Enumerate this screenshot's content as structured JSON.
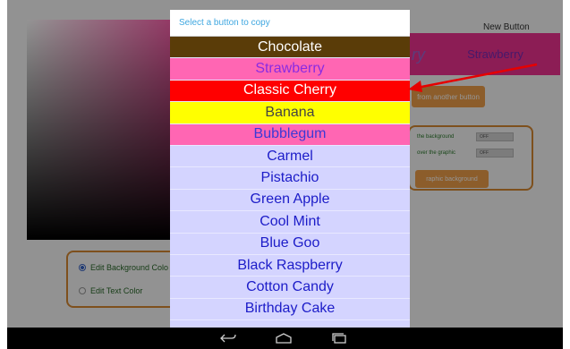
{
  "app": {
    "new_button_label": "New Button",
    "preview_text": "Strawberry",
    "preview_peek_text": "ry",
    "copy_button_label": "from another button",
    "options": {
      "row1_label": "the background",
      "row1_toggle": "OFF",
      "row2_label": "over the graphic",
      "row2_toggle": "OFF",
      "button_label": "raphic background"
    },
    "radio": {
      "edit_background": "Edit Background Colo",
      "edit_text": "Edit Text Color"
    }
  },
  "dialog": {
    "title": "Select a button to copy",
    "items": [
      {
        "label": "Chocolate",
        "bg": "#5a3c08",
        "color": "#ffffff"
      },
      {
        "label": "Strawberry",
        "bg": "#ff66b3",
        "color": "#8a2be2"
      },
      {
        "label": "Classic Cherry",
        "bg": "#ff0000",
        "color": "#ffffff"
      },
      {
        "label": "Banana",
        "bg": "#ffff00",
        "color": "#444444"
      },
      {
        "label": "Bubblegum",
        "bg": "#ff66b3",
        "color": "#3a3ad6"
      },
      {
        "label": "Carmel",
        "bg": "#d4d4ff",
        "color": "#1c1cc8"
      },
      {
        "label": "Pistachio",
        "bg": "#d4d4ff",
        "color": "#1c1cc8"
      },
      {
        "label": "Green Apple",
        "bg": "#d4d4ff",
        "color": "#1c1cc8"
      },
      {
        "label": "Cool Mint",
        "bg": "#d4d4ff",
        "color": "#1c1cc8"
      },
      {
        "label": "Blue Goo",
        "bg": "#d4d4ff",
        "color": "#1c1cc8"
      },
      {
        "label": "Black Raspberry",
        "bg": "#d4d4ff",
        "color": "#1c1cc8"
      },
      {
        "label": "Cotton Candy",
        "bg": "#d4d4ff",
        "color": "#1c1cc8"
      },
      {
        "label": "Birthday Cake",
        "bg": "#d4d4ff",
        "color": "#1c1cc8"
      }
    ]
  },
  "navbar": {
    "icons": [
      "back-icon",
      "home-icon",
      "recent-apps-icon"
    ]
  },
  "colors": {
    "accent": "#f2a14b",
    "title_blue": "#3fa7e0",
    "arrow_red": "#e60000"
  }
}
